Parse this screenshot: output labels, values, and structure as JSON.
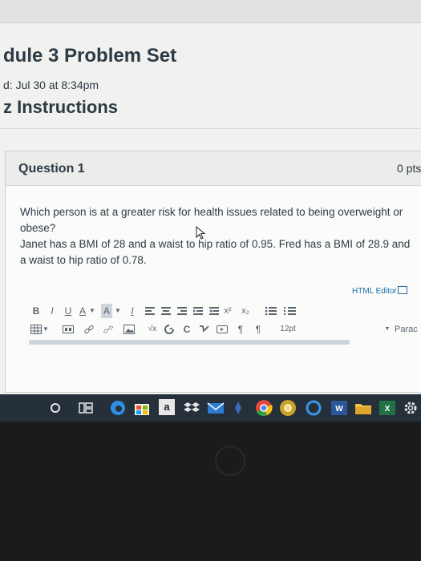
{
  "page": {
    "title": "dule 3 Problem Set",
    "due": "d: Jul 30 at 8:34pm",
    "instructions_heading": "z Instructions"
  },
  "question": {
    "title": "Question 1",
    "points": "0 pts",
    "text_line1": "Which person is at a greater risk for health issues related to being overweight or obese?",
    "text_line2": "Janet has a BMI of 28 and a waist to hip ratio of 0.95. Fred has a BMI of 28.9 and a waist to hip ratio of 0.78."
  },
  "editor": {
    "html_editor_label": "HTML Editor",
    "font_size": "12pt",
    "paragraph": "Parac",
    "toolbar_row1": [
      "bold-icon",
      "italic-icon",
      "underline-icon",
      "text-color-icon",
      "background-color-icon",
      "clear-format-icon",
      "align-left-icon",
      "align-center-icon",
      "align-right-icon",
      "indent-icon",
      "outdent-icon",
      "superscript-icon",
      "subscript-icon",
      "bullet-list-icon",
      "numbered-list-icon"
    ],
    "toolbar_row2": [
      "table-icon",
      "media-icon",
      "link-icon",
      "unlink-icon",
      "image-icon",
      "equation-icon",
      "lti-tool-icon",
      "record-icon",
      "checkmark-icon",
      "embed-icon",
      "ltr-icon",
      "rtl-icon"
    ],
    "bold": "B",
    "italic": "I",
    "underline": "U",
    "text_color": "A",
    "bg_color": "A",
    "clear_format": "I",
    "superscript": "x²",
    "subscript": "x₂",
    "equation": "√x",
    "record": "C",
    "ltr": "¶",
    "rtl": "¶"
  },
  "taskbar": {
    "icons": [
      "cortana-icon",
      "task-view-icon",
      "edge-icon",
      "store-icon",
      "amazon-icon",
      "dropbox-icon",
      "mail-icon",
      "word-pin-icon",
      "chrome-icon",
      "chrome-canary-icon",
      "cortana-ring-icon",
      "word-icon",
      "file-explorer-icon",
      "excel-icon",
      "settings-icon"
    ],
    "amazon_label": "a"
  },
  "colors": {
    "text": "#2d3b45",
    "link": "#1f6ea8",
    "taskbar": "#26303a"
  }
}
